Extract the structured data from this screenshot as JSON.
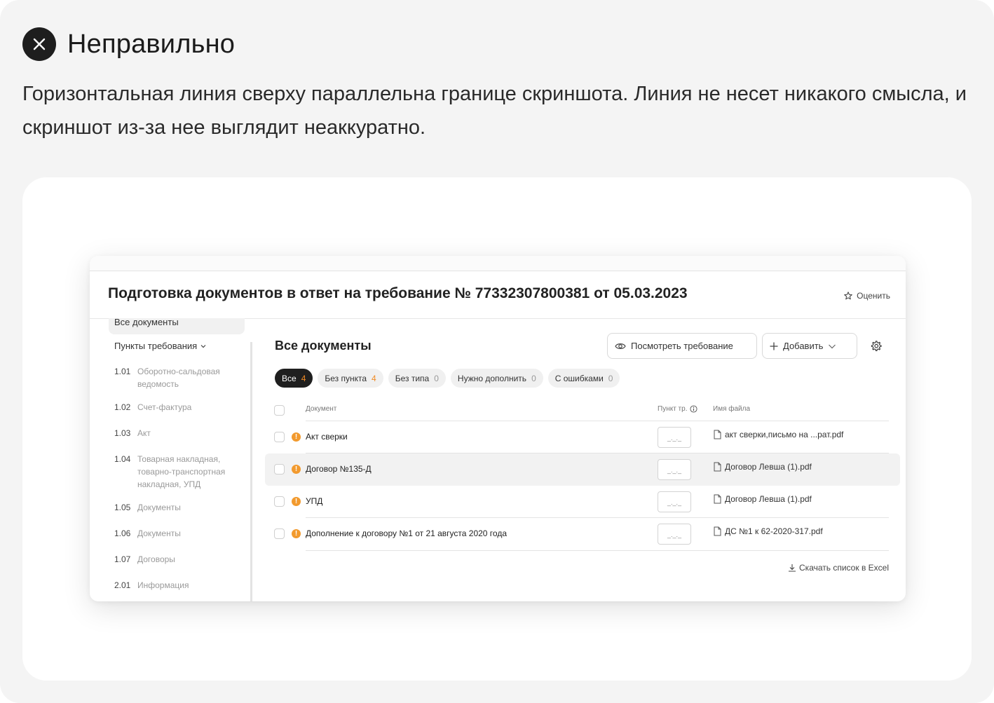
{
  "header": {
    "status_icon": "close-icon",
    "title": "Неправильно",
    "description": "Горизонтальная линия сверху параллельна границе скриншота. Линия не несет никакого смысла, и скриншот из-за нее выглядит неаккуратно."
  },
  "screenshot": {
    "title": "Подготовка документов в ответ на требование № 77332307800381 от 05.03.2023",
    "rate_label": "Оценить",
    "sidebar": {
      "cut_item": "Все документы",
      "section_label": "Пункты требования",
      "items": [
        {
          "num": "1.01",
          "label": "Оборотно-сальдовая ведомость"
        },
        {
          "num": "1.02",
          "label": "Счет-фактура"
        },
        {
          "num": "1.03",
          "label": "Акт"
        },
        {
          "num": "1.04",
          "label": "Товарная накладная, товарно-транспортная накладная, УПД"
        },
        {
          "num": "1.05",
          "label": "Документы"
        },
        {
          "num": "1.06",
          "label": "Документы"
        },
        {
          "num": "1.07",
          "label": "Договоры"
        },
        {
          "num": "2.01",
          "label": "Информация"
        }
      ]
    },
    "main": {
      "title": "Все документы",
      "view_button": "Посмотреть требование",
      "add_button": "Добавить",
      "filters": [
        {
          "label": "Все",
          "count": "4"
        },
        {
          "label": "Без пункта",
          "count": "4"
        },
        {
          "label": "Без типа",
          "count": "0"
        },
        {
          "label": "Нужно дополнить",
          "count": "0"
        },
        {
          "label": "С ошибками",
          "count": "0"
        }
      ],
      "columns": {
        "document": "Документ",
        "point": "Пункт тр.",
        "file": "Имя файла"
      },
      "rows": [
        {
          "document": "Акт сверки",
          "point": "_._._",
          "file": "акт сверки,письмо на ...рат.pdf"
        },
        {
          "document": "Договор №135-Д",
          "point": "_._._",
          "file": "Договор Левша (1).pdf"
        },
        {
          "document": "УПД",
          "point": "_._._",
          "file": "Договор Левша (1).pdf"
        },
        {
          "document": "Дополнение к договору №1 от 21 августа 2020 года",
          "point": "_._._",
          "file": "ДС №1 к 62-2020-317.pdf"
        }
      ],
      "excel_link": "Скачать список в Excel"
    }
  },
  "colors": {
    "accent_warning": "#f29a2e",
    "chip_active": "#1f1f1f",
    "page_bg": "#f4f4f4"
  }
}
